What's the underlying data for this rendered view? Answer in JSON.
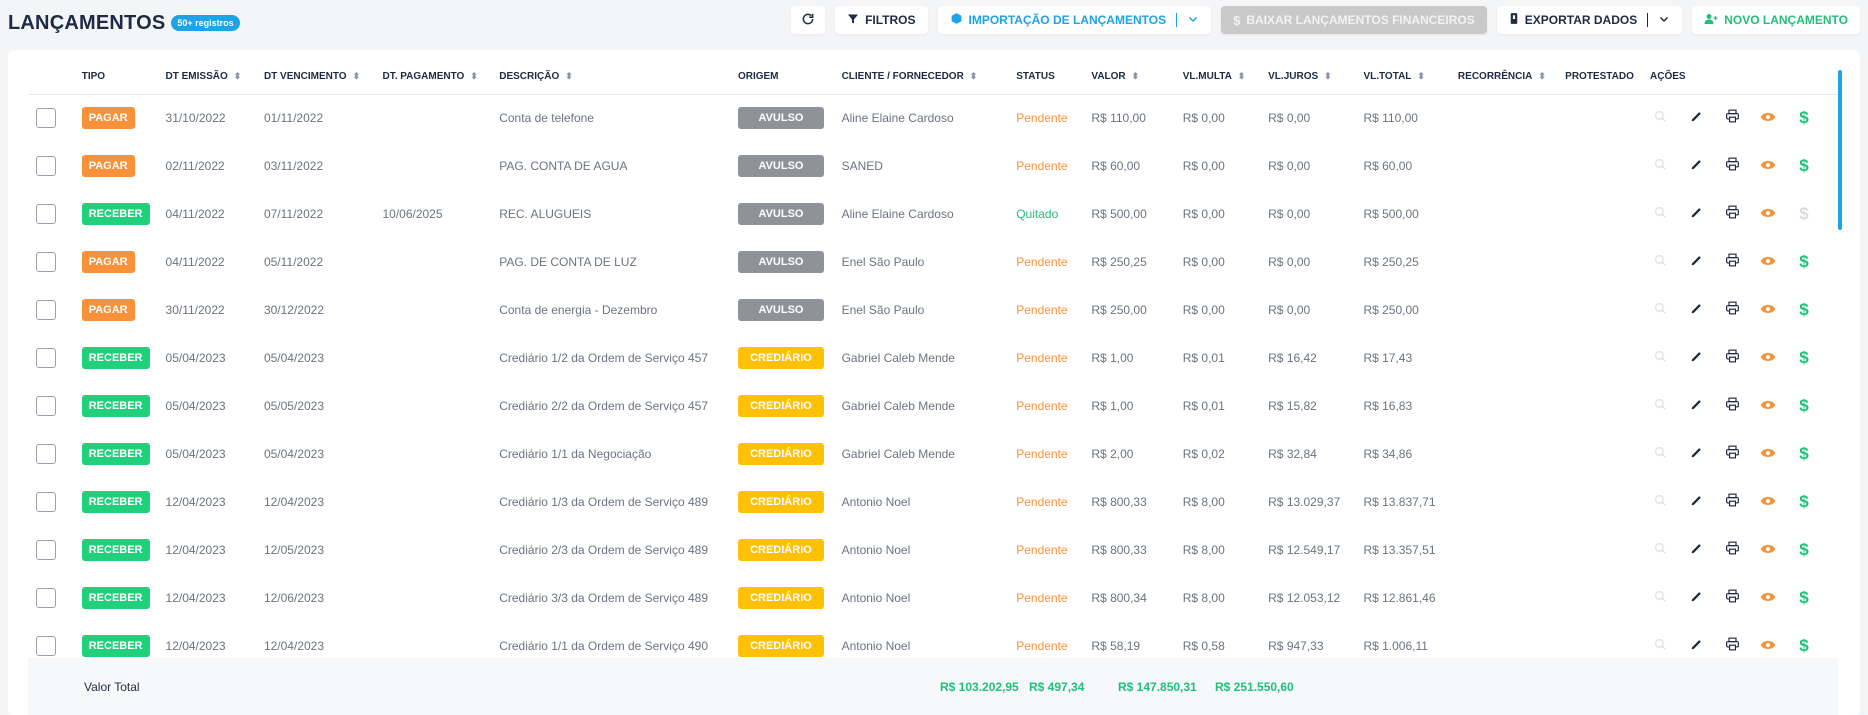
{
  "header": {
    "title": "LANÇAMENTOS",
    "count_badge": "50+ registros",
    "filters_label": "FILTROS",
    "import_label": "IMPORTAÇÃO DE LANÇAMENTOS",
    "download_label": "BAIXAR LANÇAMENTOS FINANCEIROS",
    "export_label": "EXPORTAR DADOS",
    "new_label": "NOVO LANÇAMENTO"
  },
  "table": {
    "columns": {
      "tipo": "TIPO",
      "emissao": "DT EMISSÃO",
      "vencimento": "DT VENCIMENTO",
      "pagamento": "DT. PAGAMENTO",
      "descricao": "DESCRIÇÃO",
      "origem": "ORIGEM",
      "cliente": "CLIENTE / FORNECEDOR",
      "status": "STATUS",
      "valor": "VALOR",
      "multa": "VL.MULTA",
      "juros": "VL.JUROS",
      "total": "VL.TOTAL",
      "recorrencia": "RECORRÊNCIA",
      "protestado": "PROTESTADO",
      "acoes": "AÇÕES"
    },
    "rows": [
      {
        "tipo": "PAGAR",
        "emissao": "31/10/2022",
        "vencimento": "01/11/2022",
        "pagamento": "",
        "descricao": "Conta de telefone",
        "origem": "AVULSO",
        "cliente": "Aline Elaine Cardoso",
        "status": "Pendente",
        "valor": "R$ 110,00",
        "multa": "R$ 0,00",
        "juros": "R$ 0,00",
        "total": "R$ 110,00"
      },
      {
        "tipo": "PAGAR",
        "emissao": "02/11/2022",
        "vencimento": "03/11/2022",
        "pagamento": "",
        "descricao": "PAG. CONTA DE AGUA",
        "origem": "AVULSO",
        "cliente": "SANED",
        "status": "Pendente",
        "valor": "R$ 60,00",
        "multa": "R$ 0,00",
        "juros": "R$ 0,00",
        "total": "R$ 60,00"
      },
      {
        "tipo": "RECEBER",
        "emissao": "04/11/2022",
        "vencimento": "07/11/2022",
        "pagamento": "10/06/2025",
        "descricao": "REC. ALUGUEIS",
        "origem": "AVULSO",
        "cliente": "Aline Elaine Cardoso",
        "status": "Quitado",
        "valor": "R$ 500,00",
        "multa": "R$ 0,00",
        "juros": "R$ 0,00",
        "total": "R$ 500,00"
      },
      {
        "tipo": "PAGAR",
        "emissao": "04/11/2022",
        "vencimento": "05/11/2022",
        "pagamento": "",
        "descricao": "PAG. DE CONTA DE LUZ",
        "origem": "AVULSO",
        "cliente": "Enel São Paulo",
        "status": "Pendente",
        "valor": "R$ 250,25",
        "multa": "R$ 0,00",
        "juros": "R$ 0,00",
        "total": "R$ 250,25"
      },
      {
        "tipo": "PAGAR",
        "emissao": "30/11/2022",
        "vencimento": "30/12/2022",
        "pagamento": "",
        "descricao": "Conta de energia - Dezembro",
        "origem": "AVULSO",
        "cliente": "Enel São Paulo",
        "status": "Pendente",
        "valor": "R$ 250,00",
        "multa": "R$ 0,00",
        "juros": "R$ 0,00",
        "total": "R$ 250,00"
      },
      {
        "tipo": "RECEBER",
        "emissao": "05/04/2023",
        "vencimento": "05/04/2023",
        "pagamento": "",
        "descricao": "Crediário 1/2 da Ordem de Serviço 457",
        "origem": "CREDIÁRIO",
        "cliente": "Gabriel Caleb Mende",
        "status": "Pendente",
        "valor": "R$ 1,00",
        "multa": "R$ 0,01",
        "juros": "R$ 16,42",
        "total": "R$ 17,43"
      },
      {
        "tipo": "RECEBER",
        "emissao": "05/04/2023",
        "vencimento": "05/05/2023",
        "pagamento": "",
        "descricao": "Crediário 2/2 da Ordem de Serviço 457",
        "origem": "CREDIÁRIO",
        "cliente": "Gabriel Caleb Mende",
        "status": "Pendente",
        "valor": "R$ 1,00",
        "multa": "R$ 0,01",
        "juros": "R$ 15,82",
        "total": "R$ 16,83"
      },
      {
        "tipo": "RECEBER",
        "emissao": "05/04/2023",
        "vencimento": "05/04/2023",
        "pagamento": "",
        "descricao": "Crediário 1/1 da Negociação",
        "origem": "CREDIÁRIO",
        "cliente": "Gabriel Caleb Mende",
        "status": "Pendente",
        "valor": "R$ 2,00",
        "multa": "R$ 0,02",
        "juros": "R$ 32,84",
        "total": "R$ 34,86"
      },
      {
        "tipo": "RECEBER",
        "emissao": "12/04/2023",
        "vencimento": "12/04/2023",
        "pagamento": "",
        "descricao": "Crediário 1/3 da Ordem de Serviço 489",
        "origem": "CREDIÁRIO",
        "cliente": "Antonio Noel",
        "status": "Pendente",
        "valor": "R$ 800,33",
        "multa": "R$ 8,00",
        "juros": "R$ 13.029,37",
        "total": "R$ 13.837,71"
      },
      {
        "tipo": "RECEBER",
        "emissao": "12/04/2023",
        "vencimento": "12/05/2023",
        "pagamento": "",
        "descricao": "Crediário 2/3 da Ordem de Serviço 489",
        "origem": "CREDIÁRIO",
        "cliente": "Antonio Noel",
        "status": "Pendente",
        "valor": "R$ 800,33",
        "multa": "R$ 8,00",
        "juros": "R$ 12.549,17",
        "total": "R$ 13.357,51"
      },
      {
        "tipo": "RECEBER",
        "emissao": "12/04/2023",
        "vencimento": "12/06/2023",
        "pagamento": "",
        "descricao": "Crediário 3/3 da Ordem de Serviço 489",
        "origem": "CREDIÁRIO",
        "cliente": "Antonio Noel",
        "status": "Pendente",
        "valor": "R$ 800,34",
        "multa": "R$ 8,00",
        "juros": "R$ 12.053,12",
        "total": "R$ 12.861,46"
      },
      {
        "tipo": "RECEBER",
        "emissao": "12/04/2023",
        "vencimento": "12/04/2023",
        "pagamento": "",
        "descricao": "Crediário 1/1 da Ordem de Serviço 490",
        "origem": "CREDIÁRIO",
        "cliente": "Antonio Noel",
        "status": "Pendente",
        "valor": "R$ 58,19",
        "multa": "R$ 0,58",
        "juros": "R$ 947,33",
        "total": "R$ 1.006,11"
      }
    ]
  },
  "footer": {
    "label": "Valor Total",
    "valor": "R$ 103.202,95",
    "multa": "R$ 497,34",
    "juros": "R$ 147.850,31",
    "total": "R$ 251.550,60"
  },
  "colors": {
    "primary_dark": "#1f2a44",
    "accent_blue": "#1fa3e8",
    "pagar_orange": "#f7923a",
    "receber_green": "#21d07a",
    "crediario_yellow": "#ffc107",
    "avulso_gray": "#8f9399"
  }
}
